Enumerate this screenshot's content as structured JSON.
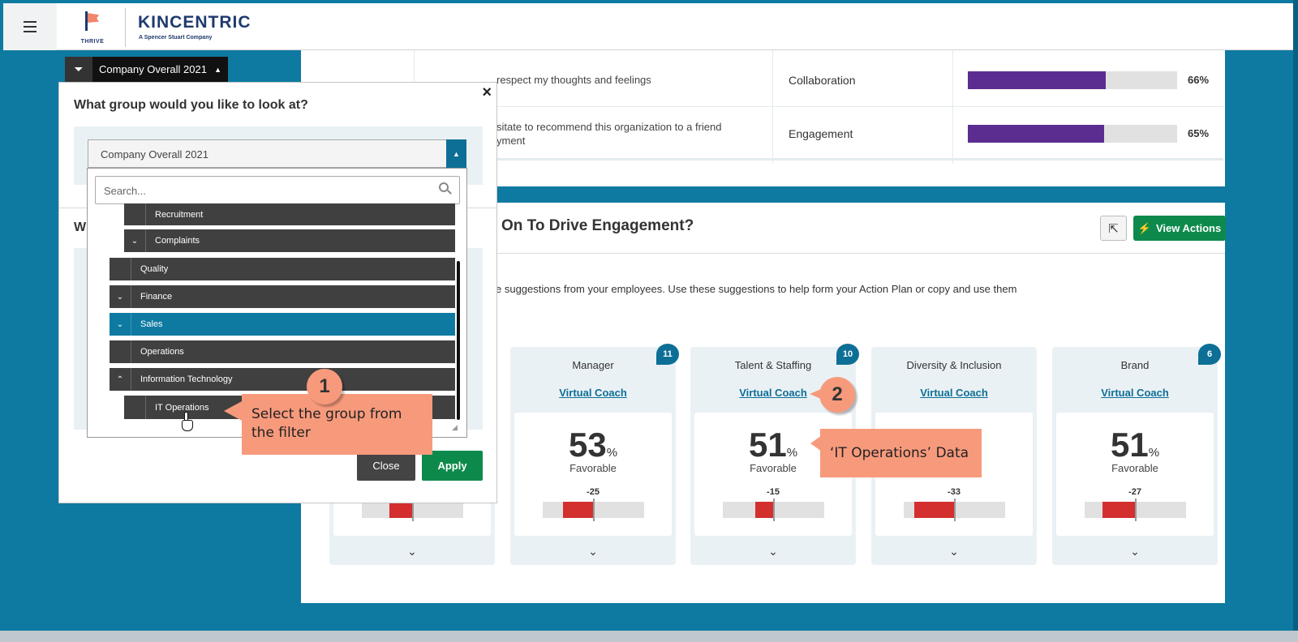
{
  "header": {
    "thrive_label": "THRIVE",
    "brand": "KINCENTRIC",
    "brand_sub": "A Spencer Stuart Company"
  },
  "filter_tab": {
    "label": "Company Overall 2021"
  },
  "top_table": {
    "rows": [
      {
        "text": "respect my thoughts and feelings",
        "dimension": "Collaboration",
        "percent": "66%",
        "fill": 0.66
      },
      {
        "text": "sitate to recommend this organization to a friend\nyment",
        "dimension": "Engagement",
        "percent": "65%",
        "fill": 0.65
      }
    ]
  },
  "engagement": {
    "title": "On To Drive Engagement?",
    "view_actions": "View Actions",
    "suggestion_text": "e suggestions from your employees. Use these suggestions to help form your Action Plan or copy and use them",
    "cards": [
      {
        "title": "Manager",
        "link": "Virtual Coach",
        "badge": "11",
        "score": "53",
        "pct": "%",
        "favorable": "Favorable",
        "diff": "-25",
        "neg": 0.4
      },
      {
        "title": "Talent & Staffing",
        "link": "Virtual Coach",
        "badge": "10",
        "score": "51",
        "pct": "%",
        "favorable": "Favorable",
        "diff": "-15",
        "neg": 0.24
      },
      {
        "title": "Diversity & Inclusion",
        "link": "Virtual Coach",
        "badge": "",
        "score": "",
        "pct": "",
        "favorable": "",
        "diff": "-33",
        "neg": 0.53
      },
      {
        "title": "Brand",
        "link": "Virtual Coach",
        "badge": "6",
        "score": "51",
        "pct": "%",
        "favorable": "Favorable",
        "diff": "-27",
        "neg": 0.43
      }
    ],
    "hidden_card": {
      "neg": 0.3
    }
  },
  "modal": {
    "close_glyph": "×",
    "question": "What group would you like to look at?",
    "selected": "Company Overall 2021",
    "second_heading": "W",
    "close_label": "Close",
    "apply_label": "Apply"
  },
  "dropdown": {
    "search_placeholder": "Search...",
    "items": [
      {
        "label": "Recruitment",
        "toggle": ""
      },
      {
        "label": "Complaints",
        "toggle": "⌄"
      },
      {
        "label": "Quality",
        "toggle": ""
      },
      {
        "label": "Finance",
        "toggle": "⌄"
      },
      {
        "label": "Sales",
        "toggle": "⌄"
      },
      {
        "label": "Operations",
        "toggle": ""
      },
      {
        "label": "Information Technology",
        "toggle": "⌃"
      },
      {
        "label": "IT Operations",
        "toggle": ""
      }
    ]
  },
  "annotations": {
    "step1_number": "1",
    "step1_text": "Select the group from the filter",
    "step2_number": "2",
    "step2_text": "‘IT Operations’ Data"
  },
  "colors": {
    "brand_blue": "#0e7aa1",
    "purple_bar": "#5c2d91",
    "green": "#0d8a4b",
    "red_bar": "#d32f2f",
    "callout": "#f79a7c"
  },
  "icons": {
    "menu": "hamburger-icon",
    "filter": "filter-icon",
    "expand": "expand-icon",
    "lightning": "lightning-icon",
    "search": "search-icon",
    "chevron": "chevron-down-icon"
  }
}
